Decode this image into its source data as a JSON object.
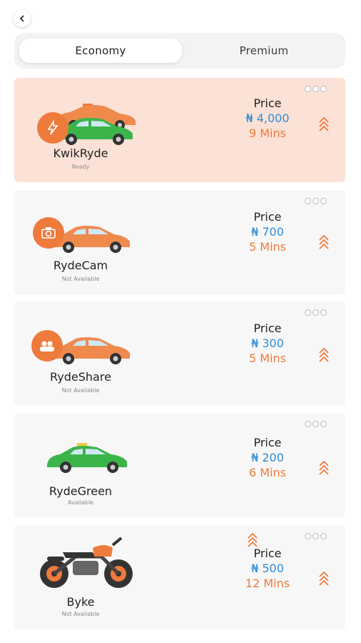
{
  "header": {
    "back_icon": "chevron-left-icon"
  },
  "tabs": [
    {
      "label": "Economy",
      "active": true
    },
    {
      "label": "Premium",
      "active": false
    }
  ],
  "rides": [
    {
      "name": "KwikRyde",
      "status": "Ready",
      "price_label": "Price",
      "price": "₦ 4,000",
      "eta": "9 Mins",
      "selected": true,
      "icon": "lightning-badge-icon"
    },
    {
      "name": "RydeCam",
      "status": "Not Available",
      "price_label": "Price",
      "price": "₦  700",
      "eta": "5 Mins",
      "selected": false,
      "icon": "camera-icon"
    },
    {
      "name": "RydeShare",
      "status": "Not Available",
      "price_label": "Price",
      "price": "₦  300",
      "eta": "5 Mins",
      "selected": false,
      "icon": "people-icon"
    },
    {
      "name": "RydeGreen",
      "status": "Available",
      "price_label": "Price",
      "price": "₦  200",
      "eta": "6 Mins",
      "selected": false,
      "icon": "taxi-icon"
    },
    {
      "name": "Byke",
      "status": "Not Available",
      "price_label": "Price",
      "price": "₦  500",
      "eta": "12 Mins",
      "selected": false,
      "icon": "motorcycle-icon"
    }
  ],
  "colors": {
    "accent_orange": "#ee7a3c",
    "price_blue": "#2f8dd8",
    "selected_bg": "#fbe1d6",
    "card_bg": "#f7f7f7",
    "car_green": "#3bb54a"
  }
}
